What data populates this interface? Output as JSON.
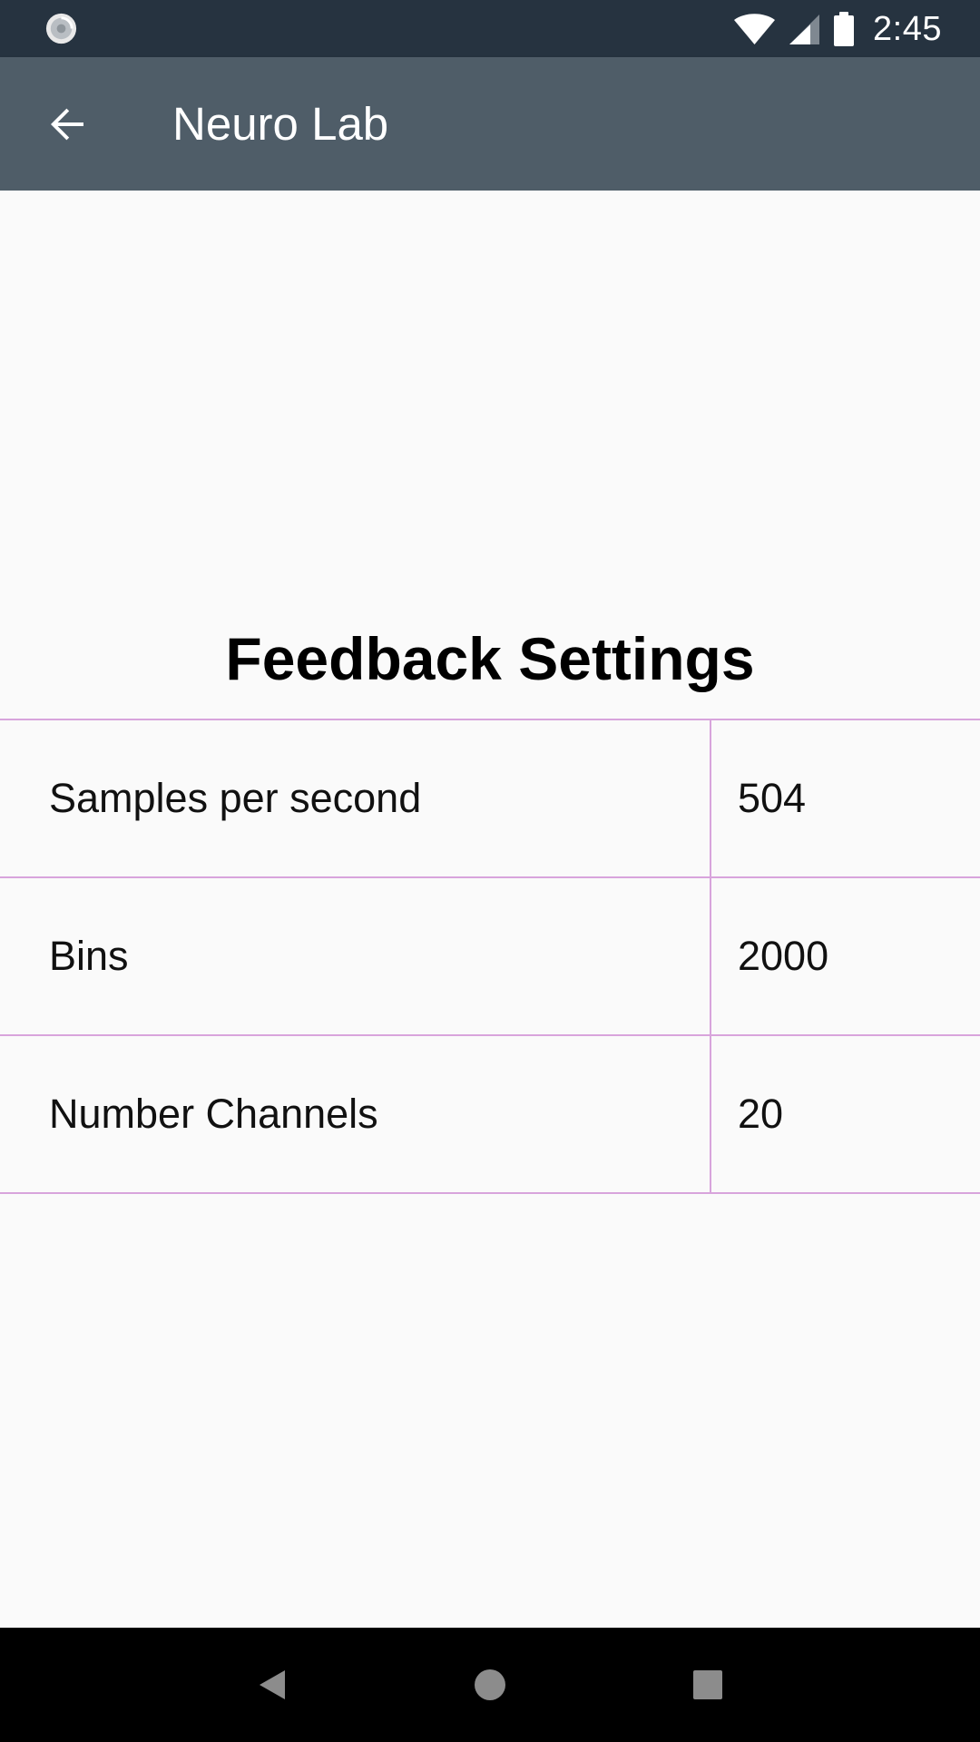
{
  "status_bar": {
    "time": "2:45",
    "icons": [
      "sync-icon",
      "wifi-icon",
      "cell-signal-icon",
      "battery-icon"
    ]
  },
  "app_bar": {
    "title": "Neuro Lab",
    "back_icon": "arrow-back-icon"
  },
  "feedback_settings": {
    "title": "Feedback Settings",
    "rows": [
      {
        "label": "Samples per second",
        "value": "504"
      },
      {
        "label": "Bins",
        "value": "2000"
      },
      {
        "label": "Number Channels",
        "value": "20"
      }
    ]
  },
  "navigation_bar": {
    "icons": [
      "nav-back-icon",
      "nav-home-icon",
      "nav-recents-icon"
    ]
  },
  "colors": {
    "status_bar": "#263340",
    "app_bar": "#4f5d68",
    "background": "#fafafa",
    "table_border": "#d8a4dc",
    "nav_bar": "#000000"
  }
}
